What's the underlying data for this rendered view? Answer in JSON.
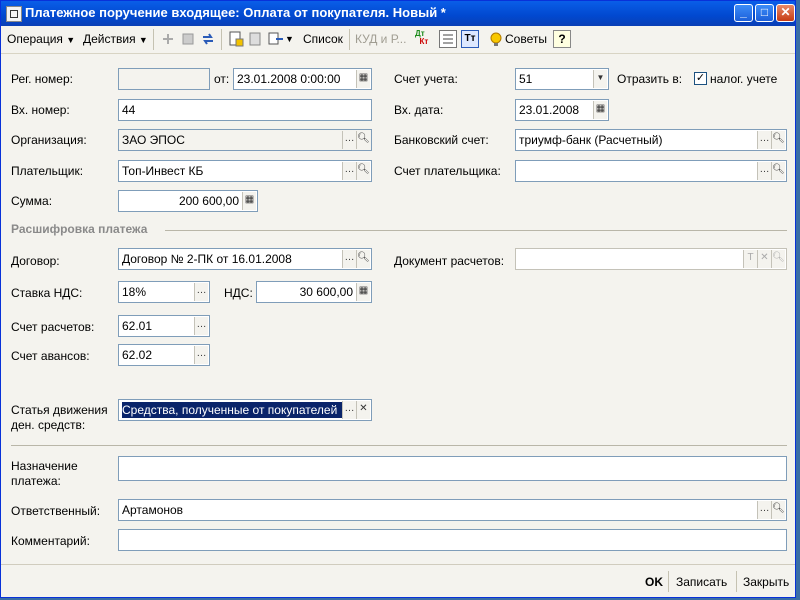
{
  "window": {
    "title": "Платежное поручение входящее: Оплата от покупателя. Новый *"
  },
  "toolbar": {
    "operation": "Операция",
    "actions": "Действия",
    "list": "Список",
    "kudir": "КУД и Р...",
    "dtkt": "Дт Кт",
    "tips": "Советы"
  },
  "form": {
    "reg_number": {
      "label": "Рег. номер:",
      "value": ""
    },
    "date_from": {
      "label": "от:",
      "value": "23.01.2008  0:00:00"
    },
    "account": {
      "label": "Счет учета:",
      "value": "51"
    },
    "reflect": {
      "label": "Отразить в:",
      "checkbox_label": "налог. учете",
      "checked": true
    },
    "in_number": {
      "label": "Вх. номер:",
      "value": "44"
    },
    "in_date": {
      "label": "Вх. дата:",
      "value": "23.01.2008"
    },
    "organization": {
      "label": "Организация:",
      "value": "ЗАО ЭПОС"
    },
    "bank_account": {
      "label": "Банковский счет:",
      "value": "триумф-банк (Расчетный)"
    },
    "payer": {
      "label": "Плательщик:",
      "value": "Топ-Инвест КБ"
    },
    "payer_account": {
      "label": "Счет плательщика:",
      "value": ""
    },
    "sum": {
      "label": "Сумма:",
      "value": "200 600,00"
    },
    "section_title": "Расшифровка платежа",
    "contract": {
      "label": "Договор:",
      "value": "Договор № 2-ПК от 16.01.2008"
    },
    "settlement_doc": {
      "label": "Документ расчетов:",
      "value": ""
    },
    "vat_rate": {
      "label": "Ставка НДС:",
      "value": "18%"
    },
    "vat": {
      "label": "НДС:",
      "value": "30 600,00"
    },
    "settlement_account": {
      "label": "Счет расчетов:",
      "value": "62.01"
    },
    "advance_account": {
      "label": "Счет авансов:",
      "value": "62.02"
    },
    "cash_flow": {
      "label_line1": "Статья движения",
      "label_line2": "ден. средств:",
      "value": "Средства, полученные от покупателей"
    },
    "purpose": {
      "label_line1": "Назначение",
      "label_line2": "платежа:",
      "value": ""
    },
    "responsible": {
      "label": "Ответственный:",
      "value": "Артамонов"
    },
    "comment": {
      "label": "Комментарий:",
      "value": ""
    }
  },
  "footer": {
    "ok": "OK",
    "save": "Записать",
    "close": "Закрыть"
  },
  "colors": {
    "titlebar": "#0148cf",
    "selection": "#0a246a",
    "window_bg": "#f4f3ee"
  }
}
